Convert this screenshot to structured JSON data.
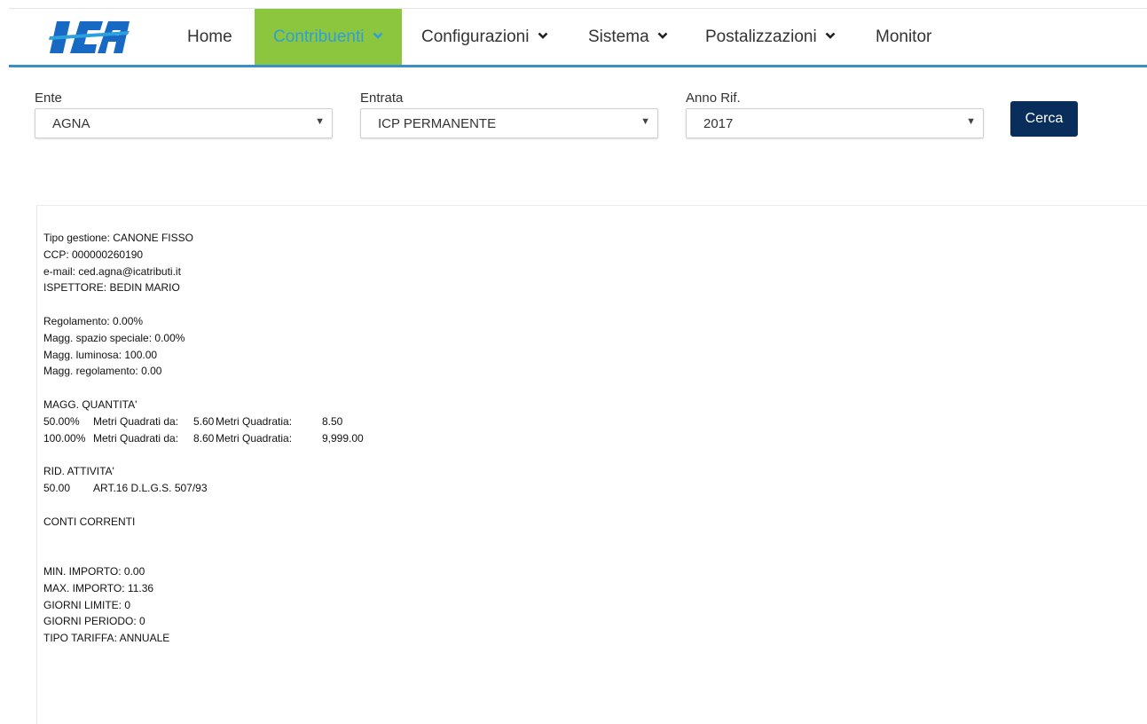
{
  "brand": {
    "logo_text": "ICA",
    "logo_color": "#1565c0"
  },
  "nav": {
    "items": [
      {
        "label": "Home",
        "dropdown": false
      },
      {
        "label": "Contribuenti",
        "dropdown": true,
        "active": true
      },
      {
        "label": "Configurazioni",
        "dropdown": true
      },
      {
        "label": "Sistema",
        "dropdown": true
      },
      {
        "label": "Postalizzazioni",
        "dropdown": true
      },
      {
        "label": "Monitor",
        "dropdown": false
      }
    ],
    "active_bg": "#8cc63e",
    "underline_color": "#3b8fc9"
  },
  "filters": {
    "ente": {
      "label": "Ente",
      "value": "AGNA"
    },
    "entrata": {
      "label": "Entrata",
      "value": "ICP PERMANENTE"
    },
    "anno": {
      "label": "Anno Rif.",
      "value": "2017"
    },
    "search_button": "Cerca"
  },
  "details": {
    "tipo_gestione": "Tipo gestione: CANONE FISSO",
    "ccp": "CCP: 000000260190",
    "email": "e-mail: ced.agna@icatributi.it",
    "ispettore": "ISPETTORE: BEDIN MARIO",
    "regolamento": "Regolamento: 0.00%",
    "magg_spazio": "Magg. spazio speciale: 0.00%",
    "magg_luminosa": "Magg. luminosa: 100.00",
    "magg_regolamento": "Magg. regolamento: 0.00",
    "magg_quantita_title": "MAGG. QUANTITA'",
    "magg_quantita_rows": [
      {
        "perc": "50.00%",
        "da_label": "Metri Quadrati da:",
        "da": "5.60",
        "a_label": "Metri Quadratia:",
        "a": "8.50"
      },
      {
        "perc": "100.00%",
        "da_label": "Metri Quadrati da:",
        "da": "8.60",
        "a_label": "Metri Quadratia:",
        "a": "9,999.00"
      }
    ],
    "rid_attivita_title": "RID. ATTIVITA'",
    "rid_value": "50.00",
    "rid_desc": "ART.16 D.L.G.S. 507/93",
    "conti_correnti": "CONTI CORRENTI",
    "min_importo": "MIN. IMPORTO: 0.00",
    "max_importo": "MAX. IMPORTO: 11.36",
    "giorni_limite": "GIORNI LIMITE: 0",
    "giorni_periodo": "GIORNI PERIODO: 0",
    "tipo_tariffa": "TIPO TARIFFA: ANNUALE"
  }
}
